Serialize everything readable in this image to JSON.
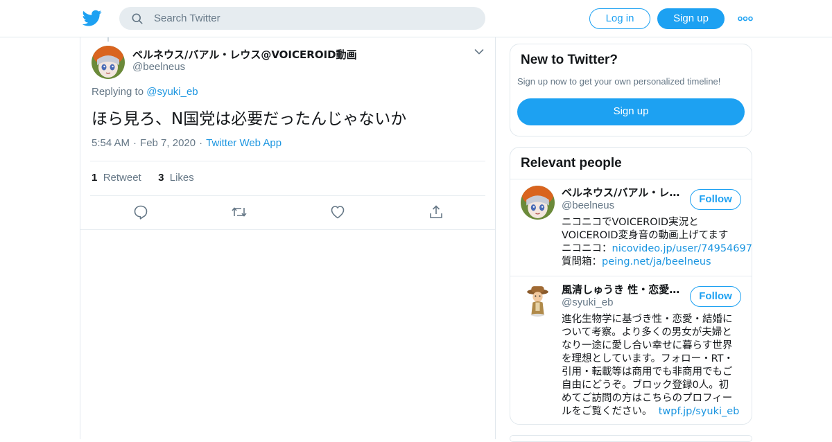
{
  "header": {
    "search_placeholder": "Search Twitter",
    "login_label": "Log in",
    "signup_label": "Sign up",
    "icons": [
      "twitter-bird-icon",
      "search-icon",
      "more-dots-icon"
    ]
  },
  "tweet": {
    "author_name": "ベルネウス/バアル・レウス@VOICEROID動画",
    "author_handle": "@beelneus",
    "replying_prefix": "Replying to",
    "replying_to": "@syuki_eb",
    "text": "ほら見ろ、N国党は必要だったんじゃないか",
    "time": "5:54 AM",
    "date": "Feb 7, 2020",
    "source": "Twitter Web App",
    "separator": "·",
    "retweet_count": "1",
    "retweet_label": "Retweet",
    "likes_count": "3",
    "likes_label": "Likes",
    "action_icons": [
      "reply-icon",
      "retweet-icon",
      "like-heart-icon",
      "share-icon"
    ]
  },
  "sidebar": {
    "new_title": "New to Twitter?",
    "new_subtitle": "Sign up now to get your own personalized timeline!",
    "new_signup_label": "Sign up",
    "people_title": "Relevant people",
    "people": [
      {
        "name": "ベルネウス/バアル・レウス@VOICEROID動画",
        "handle": "@beelneus",
        "follow_label": "Follow",
        "bio_lines": [
          "ニコニコでVOICEROID実況と",
          "VOICEROID変身音の動画上げてます"
        ],
        "bio_link1_prefix": "ニコニコ：",
        "bio_link1": "nicovideo.jp/user/74954697",
        "bio_link2_prefix": "質問箱：",
        "bio_link2": "peing.net/ja/beelneus"
      },
      {
        "name": "風清しゅうき 性・恋愛・結婚考察",
        "handle": "@syuki_eb",
        "follow_label": "Follow",
        "bio_lines": [
          "進化生物学に基づき性・恋愛・結婚に",
          "ついて考察。より多くの男女が夫婦と",
          "なり一途に愛し合い幸せに暮らす世界",
          "を理想としています。フォロー・RT・",
          "引用・転載等は商用でも非商用でもご",
          "自由にどうぞ。ブロック登録0人。初",
          "めてご訪問の方はこちらのプロフィー"
        ],
        "bio_last_prefix": "ルをご覧ください。",
        "bio_link": "twpf.jp/syuki_eb"
      }
    ]
  },
  "colors": {
    "accent": "#1da1f2",
    "link": "#1b95e0",
    "muted": "#657786",
    "border": "#e1e8ed"
  }
}
